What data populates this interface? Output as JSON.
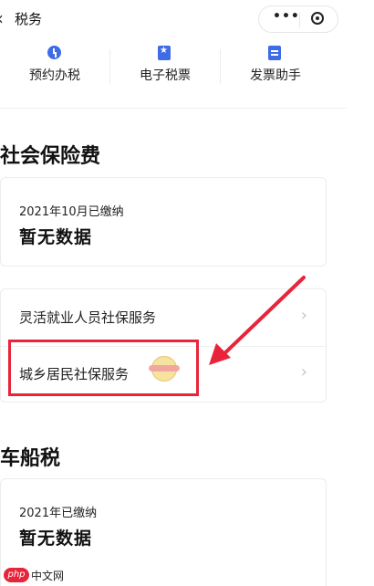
{
  "header": {
    "back_glyph": "‹",
    "title": "税务",
    "more_glyph": "•••"
  },
  "shortcuts": [
    {
      "label": "预约办税",
      "icon": "clock-icon"
    },
    {
      "label": "电子税票",
      "icon": "star-ticket-icon"
    },
    {
      "label": "发票助手",
      "icon": "invoice-icon"
    }
  ],
  "social_insurance": {
    "title": "社会保险费",
    "status": "2021年10月已缴纳",
    "value": "暂无数据",
    "links": [
      {
        "label": "灵活就业人员社保服务",
        "chevron": "›"
      },
      {
        "label": "城乡居民社保服务",
        "chevron": "›"
      }
    ]
  },
  "vehicle_tax": {
    "title": "车船税",
    "status": "2021年已缴纳",
    "value": "暂无数据"
  },
  "watermark": {
    "badge": "php",
    "text": "中文网"
  },
  "colors": {
    "accent_blue": "#3e6be6",
    "annotation_red": "#e8243a"
  }
}
